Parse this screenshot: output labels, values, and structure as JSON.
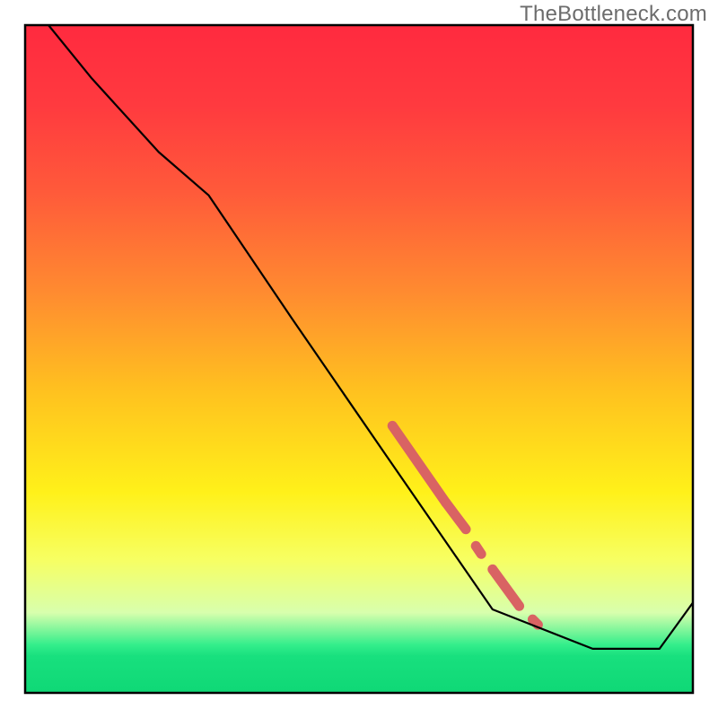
{
  "watermark": "TheBottleneck.com",
  "chart_data": {
    "type": "line",
    "title": "",
    "xlabel": "",
    "ylabel": "",
    "xlim": [
      0,
      100
    ],
    "ylim": [
      0,
      100
    ],
    "background_gradient": {
      "stops": [
        {
          "offset": 0.0,
          "color": "#ff2a3f"
        },
        {
          "offset": 0.12,
          "color": "#ff3a3f"
        },
        {
          "offset": 0.25,
          "color": "#ff5a3a"
        },
        {
          "offset": 0.4,
          "color": "#ff8b30"
        },
        {
          "offset": 0.55,
          "color": "#ffc21f"
        },
        {
          "offset": 0.7,
          "color": "#fff11a"
        },
        {
          "offset": 0.8,
          "color": "#f7ff62"
        },
        {
          "offset": 0.88,
          "color": "#d8ffad"
        },
        {
          "offset": 0.928,
          "color": "#34ee8b"
        },
        {
          "offset": 0.945,
          "color": "#18e07e"
        },
        {
          "offset": 1.0,
          "color": "#0fd876"
        }
      ]
    },
    "series": [
      {
        "name": "bottleneck-curve",
        "color": "#000000",
        "stroke_width": 2.2,
        "x": [
          3.5,
          10,
          20,
          27.5,
          40,
          55,
          70,
          85,
          95,
          100
        ],
        "y": [
          100,
          92,
          81,
          74.5,
          56,
          34.2,
          12.5,
          6.6,
          6.6,
          13.5
        ]
      }
    ],
    "highlight_segments": [
      {
        "name": "segment-a",
        "x0": 55.0,
        "y0": 40.0,
        "x1": 63.0,
        "y1": 28.5,
        "color": "#d96363",
        "width": 11
      },
      {
        "name": "segment-b",
        "x0": 63.0,
        "y0": 28.5,
        "x1": 66.0,
        "y1": 24.5,
        "color": "#d96363",
        "width": 11
      },
      {
        "name": "segment-c-dot",
        "x0": 67.5,
        "y0": 22.0,
        "x1": 68.3,
        "y1": 20.8,
        "color": "#d96363",
        "width": 11
      },
      {
        "name": "segment-d",
        "x0": 70.0,
        "y0": 18.5,
        "x1": 74.0,
        "y1": 13.0,
        "color": "#d96363",
        "width": 11
      },
      {
        "name": "segment-e-dot",
        "x0": 76.0,
        "y0": 11.0,
        "x1": 76.8,
        "y1": 10.2,
        "color": "#d96363",
        "width": 11
      }
    ],
    "frame": {
      "x": 3.5,
      "y": 3.5,
      "w": 93,
      "h": 93,
      "stroke": "#000000",
      "stroke_width": 2.5
    }
  }
}
